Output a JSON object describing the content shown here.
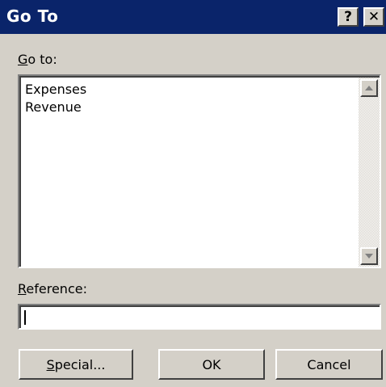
{
  "window": {
    "title": "Go To",
    "help_label": "?",
    "close_label": "✕"
  },
  "goto": {
    "label_mnemonic": "G",
    "label_rest": "o to:",
    "items": [
      "Expenses",
      "Revenue"
    ]
  },
  "reference": {
    "label_mnemonic": "R",
    "label_rest": "eference:",
    "value": ""
  },
  "buttons": {
    "special_mnemonic": "S",
    "special_rest": "pecial...",
    "ok": "OK",
    "cancel": "Cancel"
  }
}
